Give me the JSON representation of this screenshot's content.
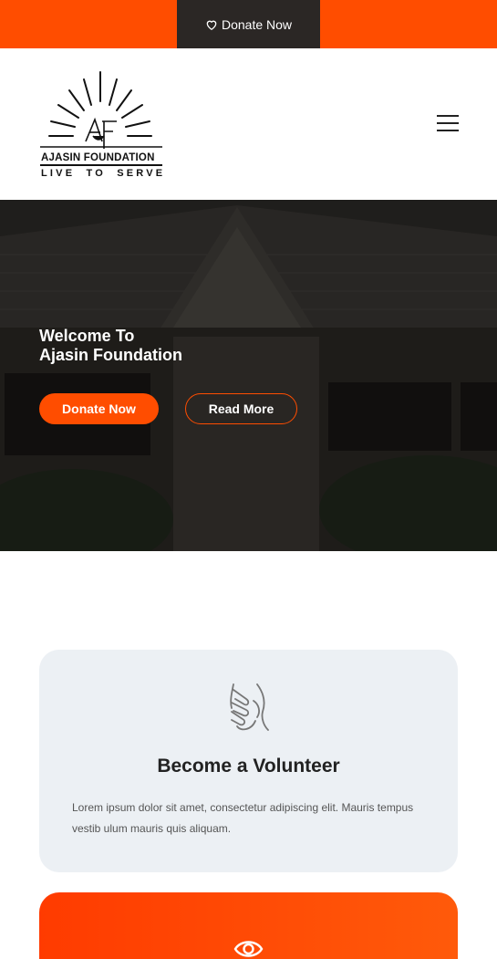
{
  "topbar": {
    "donate_label": "Donate Now",
    "donate_icon": "heart-icon",
    "background_color": "#ff4d00",
    "button_color": "#2b2725"
  },
  "header": {
    "logo_name": "AJASIN FOUNDATION",
    "logo_tagline": "LIVE TO SERVE",
    "logo_monogram": "AF",
    "menu_icon": "hamburger-menu-icon"
  },
  "hero": {
    "title_line1": "Welcome To",
    "title_line2": "Ajasin Foundation",
    "primary_button": "Donate Now",
    "secondary_button": "Read More"
  },
  "volunteer_card": {
    "icon": "helping-hands-icon",
    "title": "Become a Volunteer",
    "text": "Lorem ipsum dolor sit amet, consectetur adipiscing elit. Mauris tempus vestib ulum mauris quis aliquam."
  },
  "next_card": {
    "icon": "eye-icon"
  },
  "colors": {
    "accent": "#ff4d00",
    "card_background": "#ecf0f4",
    "heading_text": "#222222"
  }
}
